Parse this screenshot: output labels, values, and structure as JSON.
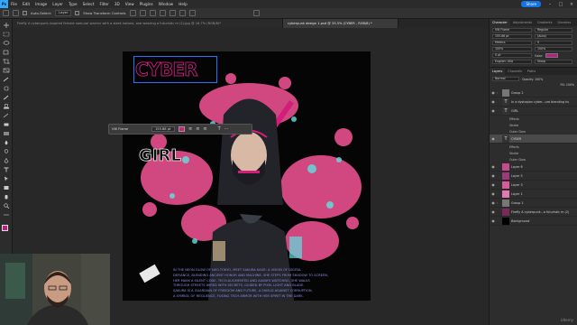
{
  "menubar": {
    "logo": "Ps",
    "items": [
      "File",
      "Edit",
      "Image",
      "Layer",
      "Type",
      "Select",
      "Filter",
      "3D",
      "View",
      "Plugins",
      "Window",
      "Help"
    ],
    "share": "Share"
  },
  "options": {
    "auto_select": "Auto-Select:",
    "layer": "Layer",
    "show_transform": "Show Transform Controls"
  },
  "tabs": [
    {
      "label": "Firefly A cyberpunk-inspired female samurai warrior with a sleek katana, one wearing a futuristic m (2).jpg @ 16.7% (RGB/8)*"
    },
    {
      "label": "cyberpunk design 1.psd @ 33.3% (CYBER , RGB/8) *"
    }
  ],
  "artboard": {
    "title_line1": "CYBER",
    "title_line2": "GIRL",
    "body_lines": [
      "IN THE NEON GLOW OF NEO-TOKYO, MEET SAKURA KAGE: A VISION OF DIGITAL",
      "DEFIANCE, BLENDING ANCIENT HONOR AND MACHINE. SHE STEPS FROM SHADOW TO SCREEN,",
      "HER MASK A SILENT CODE. TECH-AUGMENTED AND ALWAYS WATCHING, SHE WALKS",
      "THROUGH STREETS WIRED WITH SECRETS, GUIDED BY PIXEL LIGHT AND BLADE.",
      "SAKURA IS A GUARDIAN OF FREEDOM AND FUTURE, A SHIELD AGAINST CORRUPTION,",
      "A SYMBOL OF RESILIENCE, FUSING TECH ARMOR WITH HER SPIRIT IN THE DARK."
    ],
    "text_toolbar": {
      "font": "VW Flame",
      "size": "155.86 pt"
    }
  },
  "character": {
    "tabs": [
      "Character",
      "Adjustments",
      "Gradients",
      "Libraries"
    ],
    "font": "VW Flame",
    "style": "Regular",
    "size": "155.86 pt",
    "leading": "(Auto)",
    "tracking": "0",
    "kerning": "Metrics",
    "vscale": "100%",
    "hscale": "100%",
    "baseline": "0 pt",
    "color_label": "Color:",
    "language": "English: USA",
    "aa": "Sharp",
    "swatch_color": "#b81e86"
  },
  "layers": {
    "tabs": [
      "Layers",
      "Channels",
      "Paths"
    ],
    "blend": "Normal",
    "opacity": "Opacity: 100%",
    "fill": "Fill: 100%",
    "items": [
      {
        "name": "Group 2",
        "kind": "group"
      },
      {
        "name": "In a dystopian cyber...ure blending hu",
        "kind": "text"
      },
      {
        "name": "GIRL",
        "kind": "text"
      },
      {
        "name": "Effects",
        "kind": "sub"
      },
      {
        "name": "Stroke",
        "kind": "sub"
      },
      {
        "name": "Outer Glow",
        "kind": "sub"
      },
      {
        "name": "CYBER",
        "kind": "text",
        "selected": true
      },
      {
        "name": "Effects",
        "kind": "sub"
      },
      {
        "name": "Stroke",
        "kind": "sub"
      },
      {
        "name": "Outer Glow",
        "kind": "sub"
      },
      {
        "name": "Layer 6",
        "kind": "img"
      },
      {
        "name": "Layer 5",
        "kind": "img"
      },
      {
        "name": "Layer 3",
        "kind": "img"
      },
      {
        "name": "Layer 1",
        "kind": "img"
      },
      {
        "name": "Group 1",
        "kind": "group"
      },
      {
        "name": "Firefly A cyberpunk...a futuristic m (2)",
        "kind": "img"
      },
      {
        "name": "Background",
        "kind": "bg"
      }
    ]
  },
  "watermark": "Udemy"
}
